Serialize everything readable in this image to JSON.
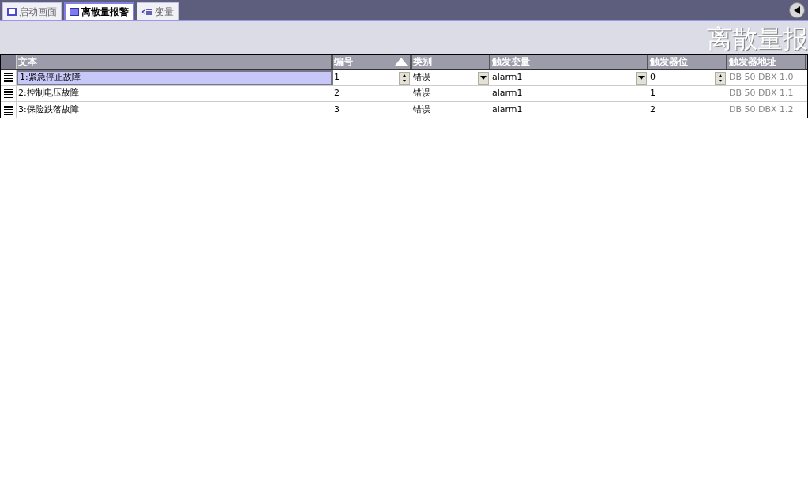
{
  "tabs": [
    {
      "label": "启动画面",
      "selected": false
    },
    {
      "label": "离散量报警",
      "selected": true
    },
    {
      "label": "变量",
      "selected": false
    }
  ],
  "banner_title": "离散量报",
  "columns": [
    {
      "label": "文本",
      "kind": "text",
      "readonly": false,
      "sorted": false
    },
    {
      "label": "编号",
      "kind": "spin",
      "readonly": false,
      "sorted": true
    },
    {
      "label": "类别",
      "kind": "dropdown",
      "readonly": false,
      "sorted": false
    },
    {
      "label": "触发变量",
      "kind": "dropdown",
      "readonly": false,
      "sorted": false
    },
    {
      "label": "触发器位",
      "kind": "spin",
      "readonly": false,
      "sorted": false
    },
    {
      "label": "触发器地址",
      "kind": "text",
      "readonly": true,
      "sorted": false
    }
  ],
  "rows": [
    {
      "selected": true,
      "cells": [
        "1:紧急停止故障",
        "1",
        "错误",
        "alarm1",
        "0",
        "DB 50 DBX 1.0"
      ]
    },
    {
      "selected": false,
      "cells": [
        "2:控制电压故障",
        "2",
        "错误",
        "alarm1",
        "1",
        "DB 50 DBX 1.1"
      ]
    },
    {
      "selected": false,
      "cells": [
        "3:保险跌落故障",
        "3",
        "错误",
        "alarm1",
        "2",
        "DB 50 DBX 1.2"
      ]
    }
  ]
}
